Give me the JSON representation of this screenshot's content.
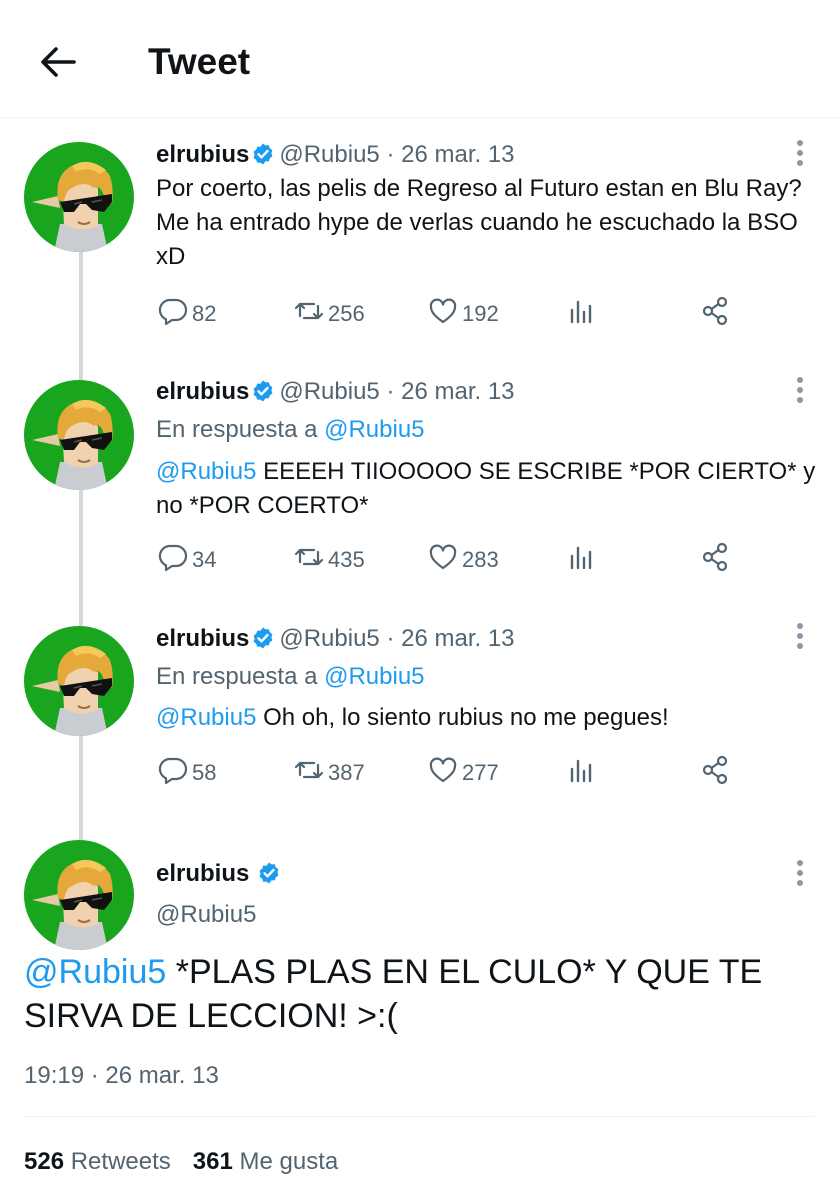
{
  "header": {
    "title": "Tweet",
    "back_icon": "arrow-left-icon"
  },
  "colors": {
    "link": "#1d9bf0",
    "muted": "#536471",
    "verified": "#1d9bf0",
    "avatar_bg": "#1aa51e"
  },
  "thread": [
    {
      "name": "elrubius",
      "handle": "@Rubiu5",
      "dot": "·",
      "date": "26 mar. 13",
      "reply_prefix": "",
      "reply_handle": "",
      "mention": "",
      "text": "Por coerto, las pelis de Regreso al Futuro estan en Blu Ray? Me ha entrado hype de verlas cuando he escuchado la BSO xD",
      "replies": "82",
      "retweets": "256",
      "likes": "192"
    },
    {
      "name": "elrubius",
      "handle": "@Rubiu5",
      "dot": "·",
      "date": "26 mar. 13",
      "reply_prefix": "En respuesta a ",
      "reply_handle": "@Rubiu5",
      "mention": "@Rubiu5",
      "text": " EEEEH TIIOOOOO SE ESCRIBE *POR CIERTO* y no *POR COERTO*",
      "replies": "34",
      "retweets": "435",
      "likes": "283"
    },
    {
      "name": "elrubius",
      "handle": "@Rubiu5",
      "dot": "·",
      "date": "26 mar. 13",
      "reply_prefix": "En respuesta a ",
      "reply_handle": "@Rubiu5",
      "mention": "@Rubiu5",
      "text": " Oh oh, lo siento rubius no me pegues!",
      "replies": "58",
      "retweets": "387",
      "likes": "277"
    }
  ],
  "main": {
    "name": "elrubius",
    "handle": "@Rubiu5",
    "mention": "@Rubiu5",
    "text": " *PLAS PLAS EN EL CULO* Y QUE TE SIRVA DE LECCION! >:(",
    "time": "19:19 · 26 mar. 13",
    "retweets_count": "526",
    "retweets_label": "Retweets",
    "likes_count": "361",
    "likes_label": "Me gusta"
  }
}
